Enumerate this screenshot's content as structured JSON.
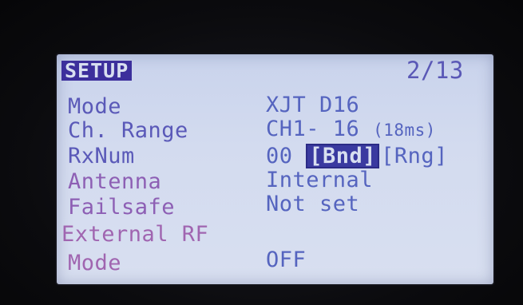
{
  "screen": {
    "title": "SETUP",
    "page": "2/13"
  },
  "rows": [
    {
      "label": "Mode",
      "value": "XJT D16"
    },
    {
      "label": "Ch. Range",
      "value": "CH1- 16",
      "value_extra": "(18ms)"
    },
    {
      "label": "RxNum",
      "value": "00",
      "bind_button": "[Bnd]",
      "range_button": "[Rng]"
    },
    {
      "label": "Antenna",
      "value": "Internal"
    },
    {
      "label": "Failsafe",
      "value": "Not set"
    }
  ],
  "section": {
    "label": "External RF"
  },
  "external_rf": {
    "mode_label": "Mode",
    "mode_value": "OFF"
  },
  "colors": {
    "lcd_background": "#d3dbef",
    "text_blue": "#5564bf",
    "text_purple": "#8d5fb4",
    "highlight": "#3c2f9c"
  }
}
